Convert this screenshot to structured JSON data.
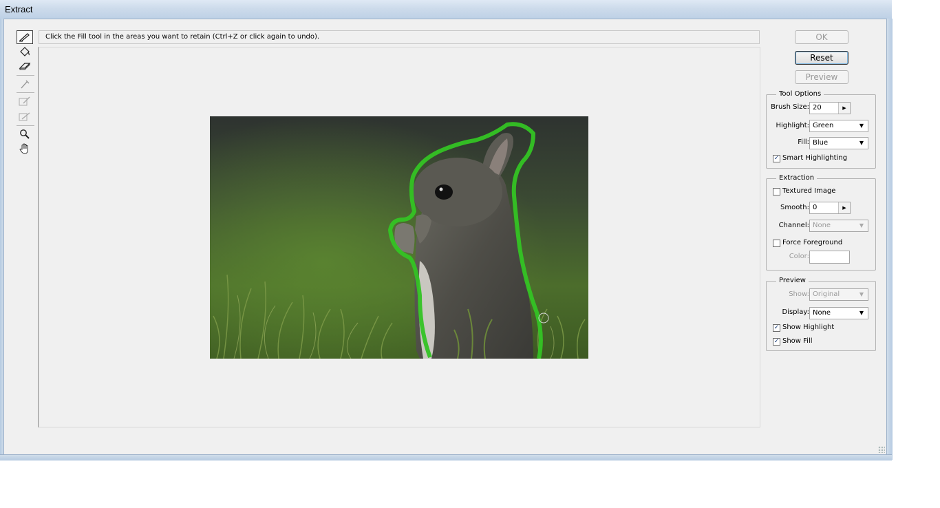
{
  "window": {
    "title": "Extract"
  },
  "instructions": "Click the Fill tool in the areas you want to retain (Ctrl+Z or click again to undo).",
  "buttons": {
    "ok": "OK",
    "reset": "Reset",
    "preview": "Preview"
  },
  "tools": [
    {
      "name": "edge-highlighter-icon",
      "glyph": "✎",
      "active": true
    },
    {
      "name": "fill-icon",
      "glyph": "⛾"
    },
    {
      "name": "eraser-icon",
      "glyph": "▱"
    },
    {
      "name": "eyedropper-icon",
      "glyph": "⁄",
      "disabled": true
    },
    {
      "name": "cleanup-icon",
      "glyph": "✐",
      "disabled": true
    },
    {
      "name": "edge-touchup-icon",
      "glyph": "✑",
      "disabled": true
    },
    {
      "name": "zoom-icon",
      "glyph": "🔍"
    },
    {
      "name": "hand-icon",
      "glyph": "✋"
    }
  ],
  "tool_options": {
    "title": "Tool Options",
    "brush_size_label": "Brush Size:",
    "brush_size_value": "20",
    "highlight_label": "Highlight:",
    "highlight_value": "Green",
    "fill_label": "Fill:",
    "fill_value": "Blue",
    "smart_highlighting_label": "Smart Highlighting",
    "smart_highlighting_checked": true
  },
  "extraction": {
    "title": "Extraction",
    "textured_image_label": "Textured Image",
    "textured_image_checked": false,
    "smooth_label": "Smooth:",
    "smooth_value": "0",
    "channel_label": "Channel:",
    "channel_value": "None",
    "force_foreground_label": "Force Foreground",
    "force_foreground_checked": false,
    "color_label": "Color:"
  },
  "preview": {
    "title": "Preview",
    "show_label": "Show:",
    "show_value": "Original",
    "display_label": "Display:",
    "display_value": "None",
    "show_highlight_label": "Show Highlight",
    "show_highlight_checked": true,
    "show_fill_label": "Show Fill",
    "show_fill_checked": true
  },
  "colors": {
    "highlight": "#34c324"
  }
}
